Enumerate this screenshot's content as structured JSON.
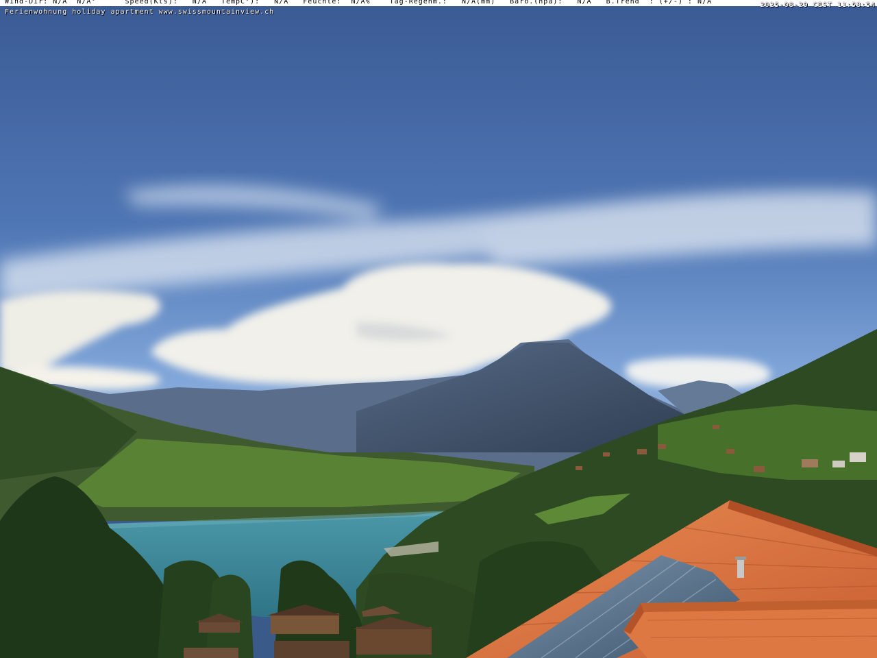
{
  "overlay": {
    "weather_line": "Wind-Dir: N/A  N/A°      Speed(Kts):   N/A   TempC°):   N/A   Feuchte:  N/A%    Tag-Regenm.:   N/A(mm)   Baro.(hpa):   N/A   B.Trend  : (+/-) : N/A",
    "timestamp": "2025-08-29 CEST 11:58:54",
    "caption": "Ferienwohnung holiday apartment www.swissmountainview.ch"
  },
  "scene": {
    "description_icons": [
      "sky",
      "clouds",
      "mountain-peak",
      "lake",
      "forest-hillside",
      "village",
      "tiled-roof",
      "solar-panels"
    ],
    "colors": {
      "sky_top": "#3e5f99",
      "sky_bottom": "#8fb2de",
      "cloud": "#f2f1ea",
      "lake": "#3f8b9d",
      "forest": "#2b4a22",
      "meadow": "#6f9a3c",
      "mountain": "#3c4c66",
      "roof": "#d8703e",
      "solar": "#4f6c86"
    }
  }
}
